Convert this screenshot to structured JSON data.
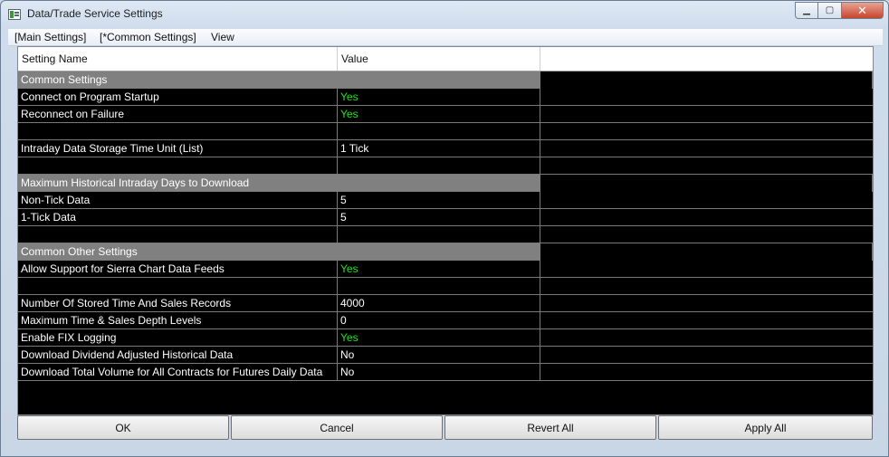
{
  "window": {
    "title": "Data/Trade Service Settings"
  },
  "menu": [
    "[Main Settings]",
    "[*Common Settings]",
    "View"
  ],
  "columns": {
    "name": "Setting Name",
    "value": "Value"
  },
  "rows": [
    {
      "type": "section",
      "name": "Common Settings"
    },
    {
      "type": "setting",
      "name": "Connect on Program Startup",
      "value": "Yes",
      "green": true
    },
    {
      "type": "setting",
      "name": "Reconnect on Failure",
      "value": "Yes",
      "green": true
    },
    {
      "type": "blank"
    },
    {
      "type": "setting",
      "name": "Intraday Data Storage Time Unit (List)",
      "value": "1 Tick"
    },
    {
      "type": "blank"
    },
    {
      "type": "section",
      "name": "Maximum Historical Intraday Days to Download"
    },
    {
      "type": "setting",
      "name": "Non-Tick Data",
      "value": "5"
    },
    {
      "type": "setting",
      "name": "1-Tick Data",
      "value": "5"
    },
    {
      "type": "blank"
    },
    {
      "type": "section",
      "name": "Common Other Settings"
    },
    {
      "type": "setting",
      "name": "Allow Support for Sierra Chart Data Feeds",
      "value": "Yes",
      "green": true
    },
    {
      "type": "blank"
    },
    {
      "type": "setting",
      "name": "Number Of Stored Time And Sales Records",
      "value": "4000"
    },
    {
      "type": "setting",
      "name": "Maximum Time & Sales Depth Levels",
      "value": "0"
    },
    {
      "type": "setting",
      "name": "Enable FIX Logging",
      "value": "Yes",
      "green": true
    },
    {
      "type": "setting",
      "name": "Download Dividend Adjusted Historical Data",
      "value": "No"
    },
    {
      "type": "setting",
      "name": "Download Total Volume for All Contracts for Futures Daily Data",
      "value": "No"
    }
  ],
  "buttons": {
    "ok": "OK",
    "cancel": "Cancel",
    "revert": "Revert All",
    "apply": "Apply All"
  },
  "colors": {
    "grid_bg": "#000000",
    "section_bg": "#808080",
    "yes_text": "#22e022"
  }
}
